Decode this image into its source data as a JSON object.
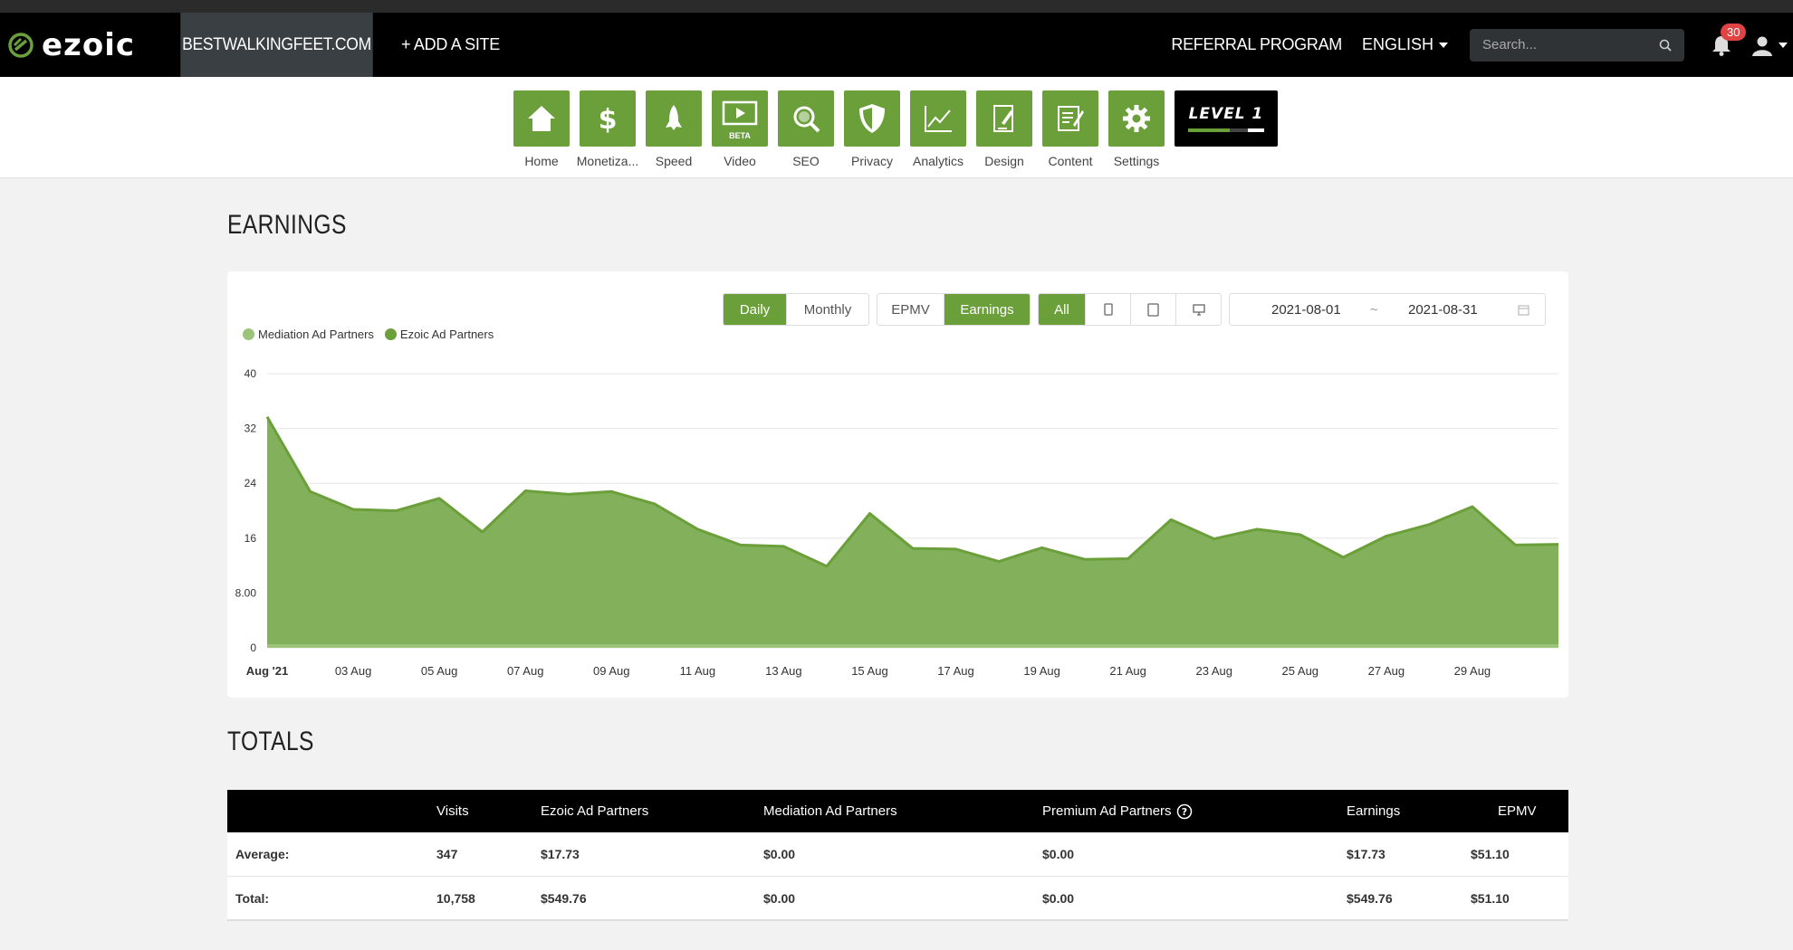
{
  "header": {
    "logo_text": "ezoic",
    "site_name": "BESTWALKINGFEET.COM",
    "add_site": "+ ADD A SITE",
    "referral": "REFERRAL PROGRAM",
    "language": "ENGLISH",
    "search_placeholder": "Search...",
    "notification_count": "30"
  },
  "toolbar": {
    "items": [
      {
        "label": "Home",
        "icon": "home-icon"
      },
      {
        "label": "Monetiza...",
        "icon": "dollar-icon"
      },
      {
        "label": "Speed",
        "icon": "rocket-icon"
      },
      {
        "label": "Video",
        "icon": "video-icon",
        "badge": "BETA"
      },
      {
        "label": "SEO",
        "icon": "magnifier-icon"
      },
      {
        "label": "Privacy",
        "icon": "shield-icon"
      },
      {
        "label": "Analytics",
        "icon": "chart-icon"
      },
      {
        "label": "Design",
        "icon": "design-icon"
      },
      {
        "label": "Content",
        "icon": "content-icon"
      },
      {
        "label": "Settings",
        "icon": "gear-icon"
      }
    ],
    "level": {
      "label": "LEVEL 1",
      "progress": 0.55
    }
  },
  "earnings": {
    "title": "EARNINGS",
    "period_buttons": [
      "Daily",
      "Monthly"
    ],
    "period_active": "Daily",
    "metric_buttons": [
      "EPMV",
      "Earnings"
    ],
    "metric_active": "Earnings",
    "device_all": "All",
    "date_start": "2021-08-01",
    "date_sep": "~",
    "date_end": "2021-08-31"
  },
  "chart_data": {
    "type": "area",
    "legend": [
      "Mediation Ad Partners",
      "Ezoic Ad Partners"
    ],
    "colors": {
      "mediation": "#9bc47a",
      "ezoic": "#6a9f3a"
    },
    "x_ticks": [
      "Aug '21",
      "03 Aug",
      "05 Aug",
      "07 Aug",
      "09 Aug",
      "11 Aug",
      "13 Aug",
      "15 Aug",
      "17 Aug",
      "19 Aug",
      "21 Aug",
      "23 Aug",
      "25 Aug",
      "27 Aug",
      "29 Aug"
    ],
    "y_ticks": [
      "0",
      "8.00",
      "16",
      "24",
      "32",
      "40"
    ],
    "ylim": [
      0,
      40
    ],
    "days": 31,
    "series": [
      {
        "name": "Ezoic Ad Partners",
        "values": [
          33.7,
          22.8,
          20.2,
          20.0,
          21.8,
          16.9,
          22.9,
          22.4,
          22.8,
          21.0,
          17.3,
          15.0,
          14.8,
          11.9,
          19.6,
          14.5,
          14.4,
          12.6,
          14.6,
          12.9,
          13.0,
          18.7,
          15.9,
          17.3,
          16.5,
          13.2,
          16.3,
          18.0,
          20.6,
          15.0,
          15.1
        ]
      },
      {
        "name": "Mediation Ad Partners",
        "values": [
          0,
          0,
          0,
          0,
          0,
          0,
          0,
          0,
          0,
          0,
          0,
          0,
          0,
          0,
          0,
          0,
          0,
          0,
          0,
          0,
          0,
          0,
          0,
          0,
          0,
          0,
          0,
          0,
          0,
          0,
          0
        ]
      }
    ]
  },
  "totals": {
    "title": "TOTALS",
    "columns": [
      "",
      "Visits",
      "Ezoic Ad Partners",
      "Mediation Ad Partners",
      "Premium Ad Partners",
      "Earnings",
      "EPMV"
    ],
    "rows": [
      [
        "Average:",
        "347",
        "$17.73",
        "$0.00",
        "$0.00",
        "$17.73",
        "$51.10"
      ],
      [
        "Total:",
        "10,758",
        "$549.76",
        "$0.00",
        "$0.00",
        "$549.76",
        "$51.10"
      ]
    ]
  }
}
